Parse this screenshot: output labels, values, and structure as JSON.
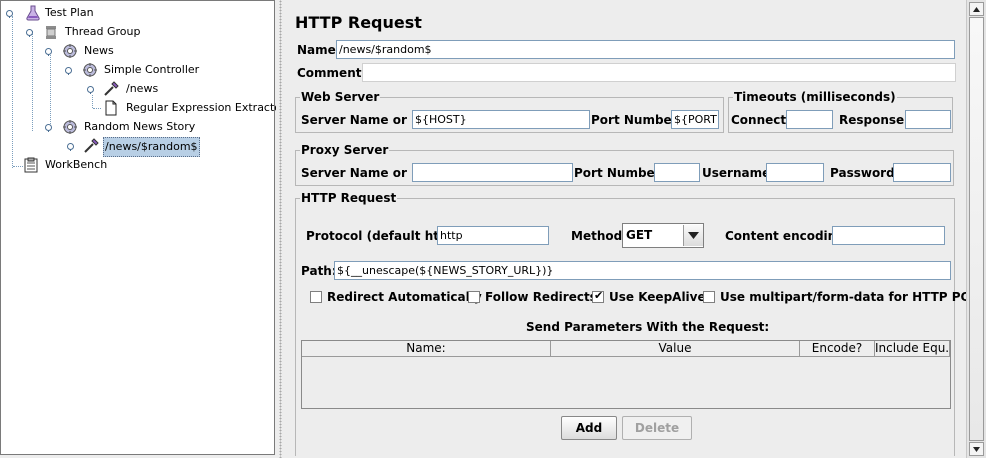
{
  "tree": {
    "nodes": [
      {
        "label": "Test Plan"
      },
      {
        "label": "Thread Group"
      },
      {
        "label": "News"
      },
      {
        "label": "Simple Controller"
      },
      {
        "label": "/news"
      },
      {
        "label": "Regular Expression Extractor"
      },
      {
        "label": "Random News Story"
      },
      {
        "label": "/news/$random$"
      },
      {
        "label": "WorkBench"
      }
    ]
  },
  "panel": {
    "title": "HTTP Request",
    "name_label": "Name:",
    "name_value": "/news/$random$",
    "comments_label": "Comments:",
    "comments_value": ""
  },
  "web_server": {
    "legend": "Web Server",
    "server_label": "Server Name or IP:",
    "server_value": "${HOST}",
    "port_label": "Port Number:",
    "port_value": "${PORT}"
  },
  "timeouts": {
    "legend": "Timeouts (milliseconds)",
    "connect_label": "Connect:",
    "connect_value": "",
    "response_label": "Response:",
    "response_value": ""
  },
  "proxy": {
    "legend": "Proxy Server",
    "server_label": "Server Name or IP:",
    "port_label": "Port Number:",
    "username_label": "Username",
    "password_label": "Password"
  },
  "http_request": {
    "legend": "HTTP Request",
    "protocol_label": "Protocol (default http):",
    "protocol_value": "http",
    "method_label": "Method:",
    "method_value": "GET",
    "encoding_label": "Content encoding:",
    "encoding_value": "",
    "path_label": "Path:",
    "path_value": "${__unescape(${NEWS_STORY_URL})}",
    "checkboxes": [
      {
        "label": "Redirect Automatically",
        "checked": false
      },
      {
        "label": "Follow Redirects",
        "checked": false
      },
      {
        "label": "Use KeepAlive",
        "checked": true
      },
      {
        "label": "Use multipart/form-data for HTTP POST",
        "checked": false
      }
    ],
    "params_title": "Send Parameters With the Request:",
    "columns": [
      "Name:",
      "Value",
      "Encode?",
      "Include Equ..."
    ],
    "add_label": "Add",
    "delete_label": "Delete"
  }
}
